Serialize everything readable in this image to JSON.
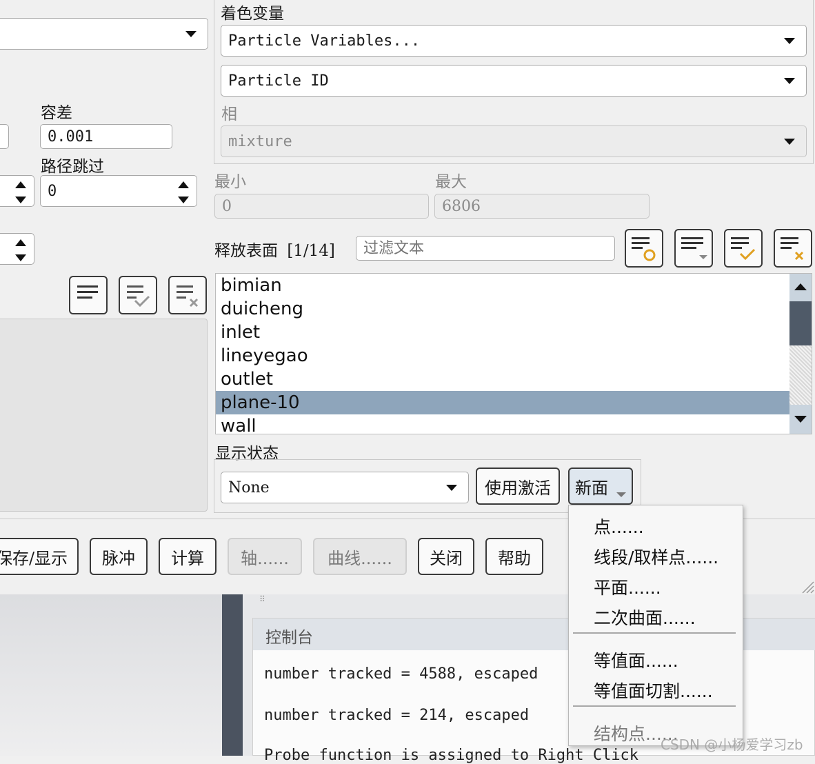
{
  "left_panel": {
    "combo_value": "",
    "tolerance_label": "容差",
    "tolerance_value": "0.001",
    "path_skip_label": "路径跳过",
    "path_skip_value": "0"
  },
  "color_section": {
    "title": "着色变量",
    "category_value": "Particle Variables...",
    "variable_value": "Particle ID",
    "phase_label": "相",
    "phase_value": "mixture"
  },
  "range": {
    "min_label": "最小",
    "min_value": "0",
    "max_label": "最大",
    "max_value": "6806"
  },
  "release_surface": {
    "label": "释放表面",
    "count": "[1/14]",
    "filter_placeholder": "过滤文本",
    "items": [
      "bimian",
      "duicheng",
      "inlet",
      "lineyegao",
      "outlet",
      "plane-10",
      "wall"
    ],
    "selected_index": 5
  },
  "display_state": {
    "label": "显示状态",
    "value": "None",
    "use_active_label": "使用激活",
    "new_surface_label": "新面"
  },
  "new_surface_menu": {
    "group1": [
      "点......",
      "线段/取样点......",
      "平面......",
      "二次曲面......"
    ],
    "group2": [
      "等值面......",
      "等值面切割......"
    ],
    "group3": [
      "结构点......"
    ]
  },
  "bottom_buttons": {
    "save_display": "保存/显示",
    "pulse": "脉冲",
    "compute": "计算",
    "axes": "轴......",
    "curves": "曲线......",
    "close": "关闭",
    "help": "帮助"
  },
  "console": {
    "title": "控制台",
    "lines": [
      "number tracked = 4588, escaped",
      "number tracked = 214, escaped",
      "Probe function is assigned to Right Click"
    ]
  },
  "watermark": "CSDN @小杨爱学习zb",
  "colors": {
    "selection": "#8ea5bb",
    "scrollbar_thumb": "#4f5a68",
    "scrollbar_track": "#c9d4de",
    "console_header": "#dfe3e8"
  }
}
